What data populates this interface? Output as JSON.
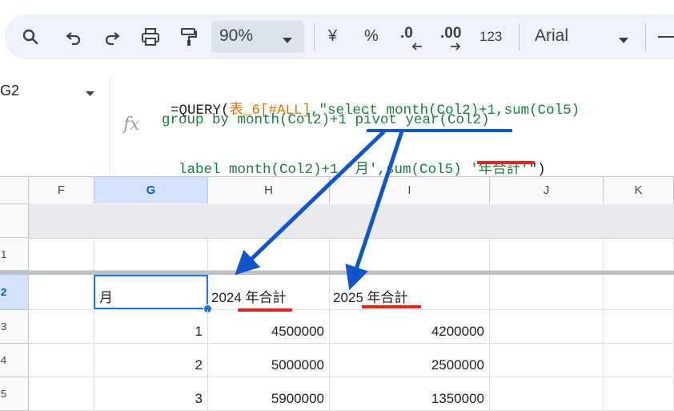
{
  "toolbar": {
    "zoom": "90%",
    "currency_symbol": "¥",
    "percent_symbol": "%",
    "decrease_decimals": ".0",
    "increase_decimals": ".00",
    "number_format": "123",
    "font_name": "Arial",
    "icons": [
      "search-icon",
      "undo-icon",
      "redo-icon",
      "print-icon",
      "paint-format-icon",
      "chevron-down-icon"
    ]
  },
  "name_box": {
    "value": "G2"
  },
  "formula": {
    "fx": "fx",
    "line1_prefix": "=QUERY(",
    "line1_range": "表_6[#ALL]",
    "line1_rest": ",\"select month(Col2)+1,sum(Col5)",
    "line2": "group by month(Col2)+1 pivot year(Col2)",
    "line3_a": "label month(Col2)+1 '月',sum(Col5) '年合計'",
    "line3_close": "\")"
  },
  "columns": [
    "F",
    "G",
    "H",
    "I",
    "J",
    "K"
  ],
  "rows": [
    {
      "num": "1",
      "cells": [
        "",
        "",
        "",
        "",
        "",
        ""
      ]
    },
    {
      "num": "2",
      "cells": [
        "",
        "月",
        "2024 年合計",
        "2025 年合計",
        "",
        ""
      ]
    },
    {
      "num": "3",
      "cells": [
        "",
        "1",
        "4500000",
        "4200000",
        "",
        ""
      ]
    },
    {
      "num": "4",
      "cells": [
        "",
        "2",
        "5000000",
        "2500000",
        "",
        ""
      ]
    },
    {
      "num": "5",
      "cells": [
        "",
        "3",
        "5900000",
        "1350000",
        "",
        ""
      ]
    }
  ],
  "colors": {
    "selection": "#1a73e8",
    "annotation_red": "#e1251b",
    "annotation_blue": "#1155cc"
  }
}
